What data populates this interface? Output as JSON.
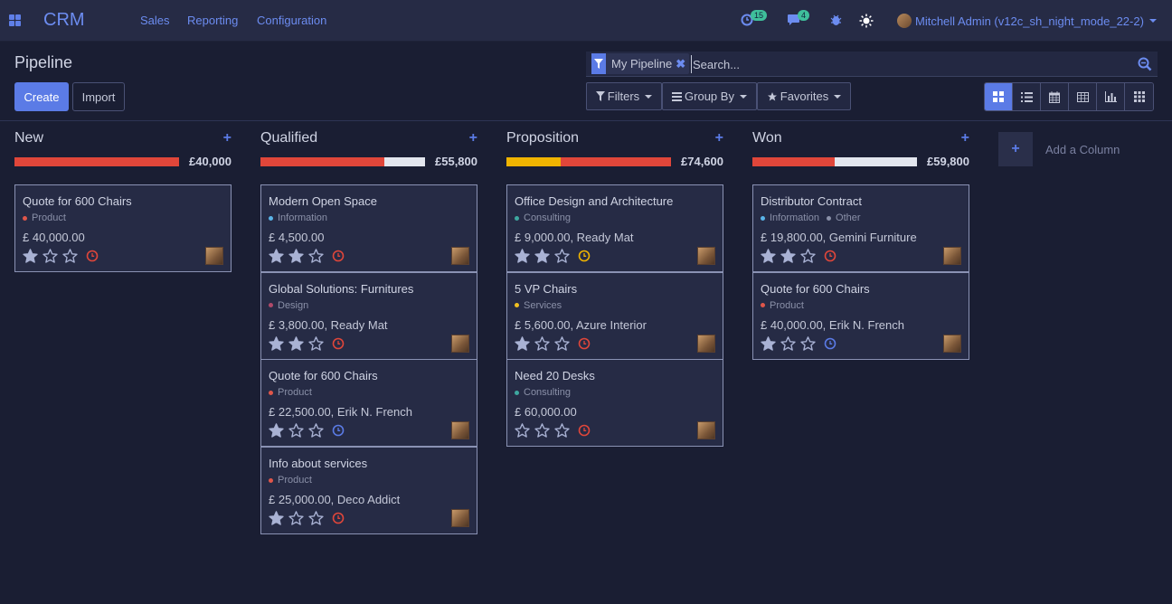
{
  "navbar": {
    "brand": "CRM",
    "menu": [
      "Sales",
      "Reporting",
      "Configuration"
    ],
    "activity_count": "15",
    "message_count": "4",
    "user_name": "Mitchell Admin (v12c_sh_night_mode_22-2)"
  },
  "control": {
    "title": "Pipeline",
    "create_label": "Create",
    "import_label": "Import",
    "facet_label": "My Pipeline",
    "search_placeholder": "Search...",
    "filters_label": "Filters",
    "groupby_label": "Group By",
    "favorites_label": "Favorites",
    "views": [
      "kanban",
      "list",
      "calendar",
      "pivot",
      "graph",
      "cohort"
    ],
    "active_view": "kanban"
  },
  "colors": {
    "accent": "#5b7be6",
    "red": "#e0463a",
    "yellow": "#f0b400",
    "gray": "#e3e6ee",
    "blue": "#5b7be6"
  },
  "columns": [
    {
      "title": "New",
      "total": "£40,000",
      "progress": [
        {
          "color": "red",
          "fraction": 1.0
        }
      ],
      "cards": [
        {
          "title": "Quote for 600 Chairs",
          "tags": [
            {
              "label": "Product",
              "color": "#e0564a"
            }
          ],
          "amount": "£ 40,000.00",
          "stars": 1,
          "activity": "red"
        }
      ]
    },
    {
      "title": "Qualified",
      "total": "£55,800",
      "progress": [
        {
          "color": "red",
          "fraction": 0.75
        },
        {
          "color": "gray",
          "fraction": 0.25
        }
      ],
      "cards": [
        {
          "title": "Modern Open Space",
          "tags": [
            {
              "label": "Information",
              "color": "#5ab4e8"
            }
          ],
          "amount": "£ 4,500.00",
          "stars": 2,
          "activity": "red"
        },
        {
          "title": "Global Solutions: Furnitures",
          "tags": [
            {
              "label": "Design",
              "color": "#b04a6a"
            }
          ],
          "amount": "£ 3,800.00, Ready Mat",
          "stars": 2,
          "activity": "red"
        },
        {
          "title": "Quote for 600 Chairs",
          "tags": [
            {
              "label": "Product",
              "color": "#e0564a"
            }
          ],
          "amount": "£ 22,500.00, Erik N. French",
          "stars": 1,
          "activity": "blue"
        },
        {
          "title": "Info about services",
          "tags": [
            {
              "label": "Product",
              "color": "#e0564a"
            }
          ],
          "amount": "£ 25,000.00, Deco Addict",
          "stars": 1,
          "activity": "red"
        }
      ]
    },
    {
      "title": "Proposition",
      "total": "£74,600",
      "progress": [
        {
          "color": "yellow",
          "fraction": 0.33
        },
        {
          "color": "red",
          "fraction": 0.67
        }
      ],
      "cards": [
        {
          "title": "Office Design and Architecture",
          "tags": [
            {
              "label": "Consulting",
              "color": "#3ea8a0"
            }
          ],
          "amount": "£ 9,000.00, Ready Mat",
          "stars": 2,
          "activity": "yellow"
        },
        {
          "title": "5 VP Chairs",
          "tags": [
            {
              "label": "Services",
              "color": "#f0c020"
            }
          ],
          "amount": "£ 5,600.00, Azure Interior",
          "stars": 1,
          "activity": "red"
        },
        {
          "title": "Need 20 Desks",
          "tags": [
            {
              "label": "Consulting",
              "color": "#3ea8a0"
            }
          ],
          "amount": "£ 60,000.00",
          "stars": 0,
          "activity": "red"
        }
      ]
    },
    {
      "title": "Won",
      "total": "£59,800",
      "progress": [
        {
          "color": "red",
          "fraction": 0.5
        },
        {
          "color": "gray",
          "fraction": 0.5
        }
      ],
      "cards": [
        {
          "title": "Distributor Contract",
          "tags": [
            {
              "label": "Information",
              "color": "#5ab4e8"
            },
            {
              "label": "Other",
              "color": "#8a90a8"
            }
          ],
          "amount": "£ 19,800.00, Gemini Furniture",
          "stars": 2,
          "activity": "red"
        },
        {
          "title": "Quote for 600 Chairs",
          "tags": [
            {
              "label": "Product",
              "color": "#e0564a"
            }
          ],
          "amount": "£ 40,000.00, Erik N. French",
          "stars": 1,
          "activity": "blue"
        }
      ]
    }
  ],
  "add_column_label": "Add a Column"
}
